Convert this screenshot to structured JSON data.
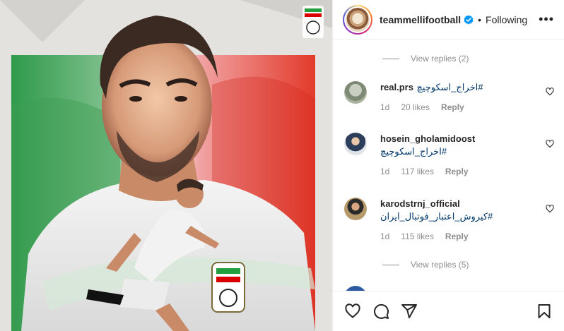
{
  "post": {
    "account": "teammellifootball",
    "follow_status": "Following",
    "separator": "•",
    "more": "•••"
  },
  "comments": {
    "view_replies_top": "View replies (2)",
    "items": [
      {
        "user": "real.prs",
        "text": "اخراج_اسکوچیچ#",
        "time": "1d",
        "likes": "20 likes",
        "reply": "Reply"
      },
      {
        "user": "hosein_gholamidoost",
        "text": "اخراج_اسکوچیچ#",
        "time": "1d",
        "likes": "117 likes",
        "reply": "Reply"
      },
      {
        "user": "karodstrnj_official",
        "text": "کیروش_اعتبار_فوتبال_ایران#",
        "time": "1d",
        "likes": "115 likes",
        "reply": "Reply"
      }
    ],
    "view_replies_bottom": "View replies (5)"
  },
  "icons": {
    "like": "heart-icon",
    "comment": "comment-icon",
    "share": "send-icon",
    "save": "bookmark-icon",
    "verified": "verified-badge-icon",
    "comment_like": "heart-outline-icon"
  },
  "colors": {
    "verified_blue": "#0095f6",
    "link_blue": "#00376b",
    "muted_gray": "#8e8e8e",
    "flag_green": "#239f40",
    "flag_red": "#da0000"
  }
}
